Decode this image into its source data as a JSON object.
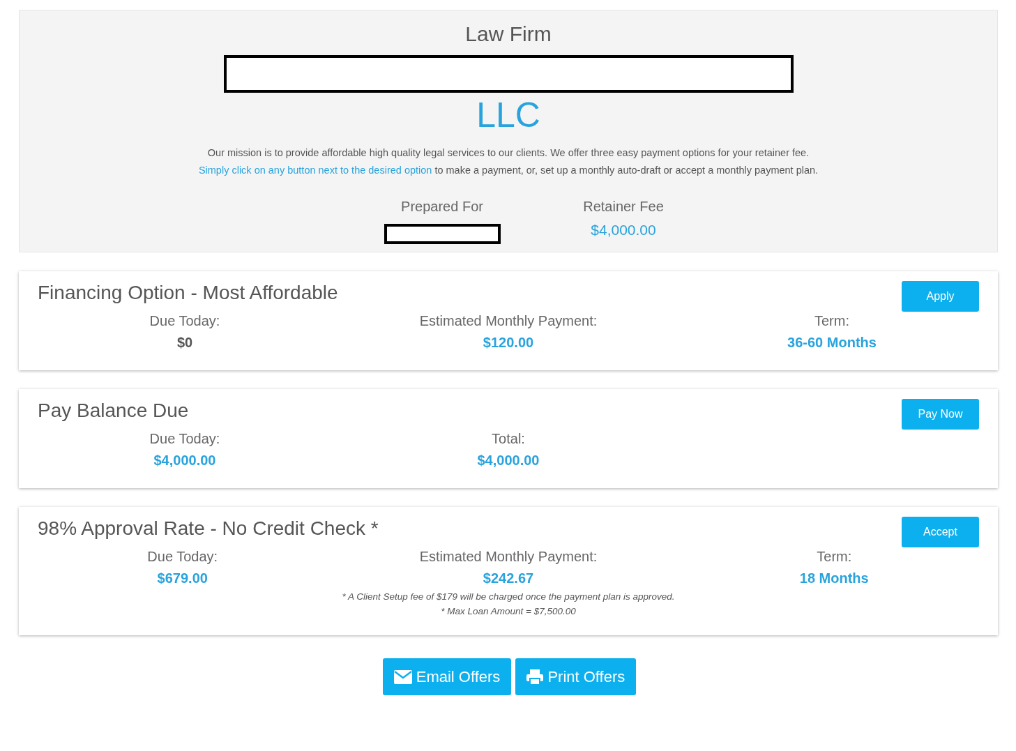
{
  "header": {
    "title": "Law Firm",
    "subtitle": "LLC",
    "mission": "Our mission is to provide affordable high quality legal services to our clients. We offer three easy payment options for your retainer fee.",
    "link": "Simply click on any button next to the desired option",
    "mission_rest": "to make a payment, or, set up a monthly auto-draft or accept a monthly payment plan.",
    "prepared_for": {
      "label": "Prepared For"
    },
    "retainer": {
      "label": "Retainer Fee",
      "value": "$4,000.00"
    }
  },
  "options": [
    {
      "title": "Financing Option - Most Affordable",
      "button": "Apply",
      "columns": [
        {
          "label": "Due Today:",
          "value": "$0",
          "highlighted": false
        },
        {
          "label": "Estimated Monthly Payment:",
          "value": "$120.00",
          "highlighted": true
        },
        {
          "label": "Term:",
          "value": "36-60 Months",
          "highlighted": true
        }
      ]
    },
    {
      "title": "Pay Balance Due",
      "button": "Pay Now",
      "columns": [
        {
          "label": "Due Today:",
          "value": "$4,000.00",
          "highlighted": true
        },
        {
          "label": "Total:",
          "value": "$4,000.00",
          "highlighted": true
        }
      ]
    },
    {
      "title": "98% Approval Rate - No Credit Check *",
      "button": "Accept",
      "columns": [
        {
          "label": "Due Today:",
          "value": "$679.00",
          "highlighted": true
        },
        {
          "label": "Estimated Monthly Payment:",
          "value": "$242.67",
          "highlighted": true,
          "notes": [
            "* A Client Setup fee of $179 will be charged once the payment plan is approved.",
            "* Max Loan Amount = $7,500.00"
          ]
        },
        {
          "label": "Term:",
          "value": "18 Months",
          "highlighted": true
        }
      ]
    }
  ],
  "actions": [
    {
      "kind": "email",
      "label": "Email Offers"
    },
    {
      "kind": "print",
      "label": "Print Offers"
    }
  ]
}
